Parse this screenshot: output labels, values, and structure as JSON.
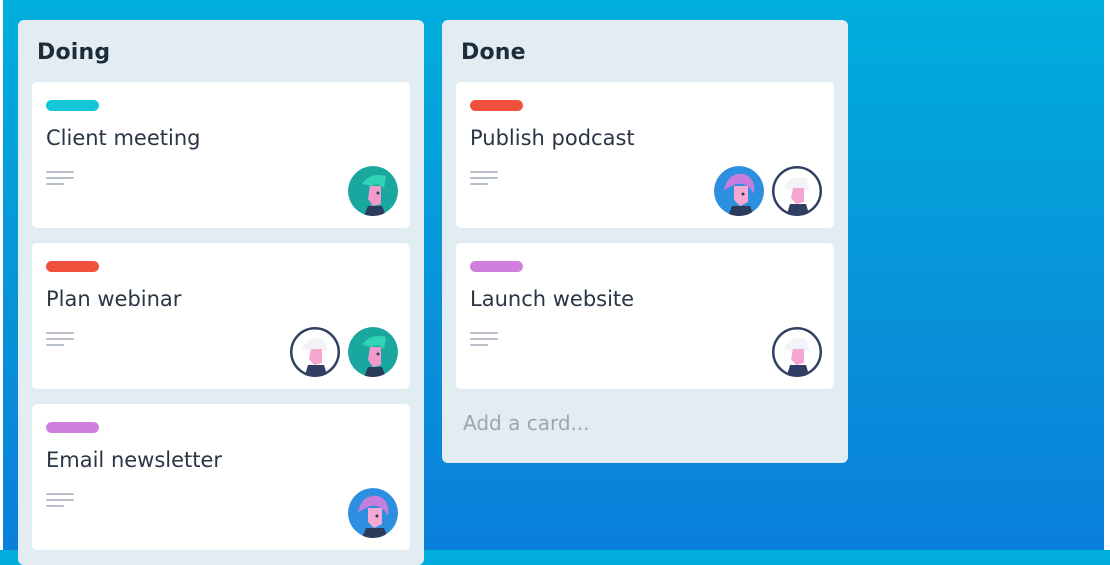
{
  "lists": [
    {
      "title": "Doing",
      "cards": [
        {
          "title": "Client meeting",
          "label_color": "#14c6d8",
          "avatars": [
            "teal-avatar"
          ]
        },
        {
          "title": "Plan webinar",
          "label_color": "#f2503e",
          "avatars": [
            "white-avatar",
            "teal-avatar"
          ]
        },
        {
          "title": "Email newsletter",
          "label_color": "#cf7fdc",
          "avatars": [
            "blue-avatar"
          ]
        }
      ]
    },
    {
      "title": "Done",
      "cards": [
        {
          "title": "Publish podcast",
          "label_color": "#f2503e",
          "avatars": [
            "blue-avatar",
            "white-avatar"
          ]
        },
        {
          "title": "Launch website",
          "label_color": "#cf7fdc",
          "avatars": [
            "white-avatar"
          ]
        }
      ],
      "add_card_text": "Add a card..."
    }
  ],
  "icons": {
    "description": "description-lines-icon"
  },
  "colors": {
    "background_top": "#00aedc",
    "background_bottom": "#0a7fdb",
    "list_background": "#e2edf3",
    "card_background": "#ffffff"
  }
}
